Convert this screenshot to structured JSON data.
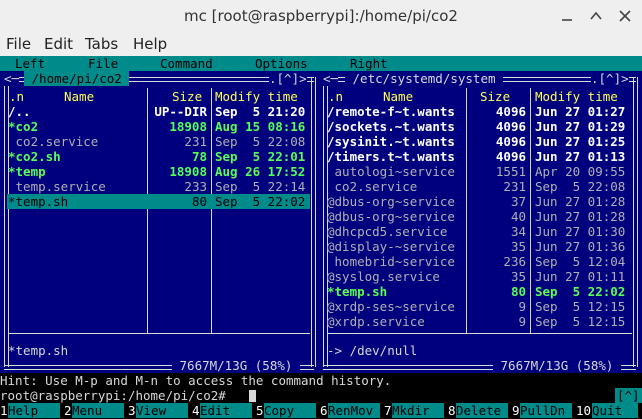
{
  "window": {
    "title": "mc [root@raspberrypi]:/home/pi/co2"
  },
  "app_menu": [
    "File",
    "Edit",
    "Tabs",
    "Help"
  ],
  "mc_menu": [
    "Left",
    "File",
    "Command",
    "Options",
    "Right"
  ],
  "left": {
    "path": " /home/pi/co2 ",
    "corner": ".[^]>",
    "cols": {
      "n": ".n",
      "name": "Name",
      "size": "Size",
      "modify": "Modify time"
    },
    "files": [
      {
        "n": "/..",
        "size": "UP--DIR",
        "mod": "Sep  5 21:20",
        "kind": "updir"
      },
      {
        "n": "*co2",
        "size": "18908",
        "mod": "Aug 15 08:16",
        "kind": "exec"
      },
      {
        "n": " co2.service",
        "size": "231",
        "mod": "Sep  5 22:08",
        "kind": "file"
      },
      {
        "n": "*co2.sh",
        "size": "78",
        "mod": "Sep  5 22:01",
        "kind": "exec"
      },
      {
        "n": "*temp",
        "size": "18908",
        "mod": "Aug 26 17:52",
        "kind": "exec"
      },
      {
        "n": " temp.service",
        "size": "233",
        "mod": "Sep  5 22:14",
        "kind": "file"
      },
      {
        "n": "*temp.sh",
        "size": "80",
        "mod": "Sep  5 22:02",
        "kind": "selected"
      }
    ],
    "status": "*temp.sh",
    "disk": " 7667M/13G (58%) "
  },
  "right": {
    "path": " /etc/systemd/system ",
    "corner": ".[^]>",
    "cols": {
      "n": ".n",
      "name": "Name",
      "size": "Size",
      "modify": "Modify time"
    },
    "files": [
      {
        "n": "/remote-f~t.wants",
        "size": "4096",
        "mod": "Jun 27 01:27",
        "kind": "dir"
      },
      {
        "n": "/sockets.~t.wants",
        "size": "4096",
        "mod": "Jun 27 01:29",
        "kind": "dir"
      },
      {
        "n": "/sysinit.~t.wants",
        "size": "4096",
        "mod": "Jun 27 01:25",
        "kind": "dir"
      },
      {
        "n": "/timers.t~t.wants",
        "size": "4096",
        "mod": "Jun 27 01:13",
        "kind": "dir"
      },
      {
        "n": " autologi~service",
        "size": "1551",
        "mod": "Apr 20 09:55",
        "kind": "file"
      },
      {
        "n": " co2.service",
        "size": "231",
        "mod": "Sep  5 22:08",
        "kind": "file"
      },
      {
        "n": "@dbus-org~service",
        "size": "37",
        "mod": "Jun 27 01:28",
        "kind": "file"
      },
      {
        "n": "@dbus-org~service",
        "size": "40",
        "mod": "Jun 27 01:28",
        "kind": "file"
      },
      {
        "n": "@dhcpcd5.service",
        "size": "34",
        "mod": "Jun 27 01:30",
        "kind": "file"
      },
      {
        "n": "@display-~service",
        "size": "35",
        "mod": "Jun 27 01:36",
        "kind": "file"
      },
      {
        "n": " homebrid~service",
        "size": "236",
        "mod": "Sep  5 12:04",
        "kind": "file"
      },
      {
        "n": "@syslog.service",
        "size": "35",
        "mod": "Jun 27 01:11",
        "kind": "file"
      },
      {
        "n": "*temp.sh",
        "size": "80",
        "mod": "Sep  5 22:02",
        "kind": "exec"
      },
      {
        "n": "@xrdp-ses~service",
        "size": "9",
        "mod": "Sep  5 12:15",
        "kind": "file"
      },
      {
        "n": "@xrdp.service",
        "size": "9",
        "mod": "Sep  5 12:15",
        "kind": "file"
      }
    ],
    "status": "-> /dev/null",
    "disk": " 7667M/13G (58%) "
  },
  "hint": "Hint: Use M-p and M-n to access the command history.",
  "hint_corner": "[^]",
  "prompt": "root@raspberrypi:/home/pi/co2# ",
  "fkeys": [
    {
      "num": "1",
      "label": "Help"
    },
    {
      "num": "2",
      "label": "Menu"
    },
    {
      "num": "3",
      "label": "View"
    },
    {
      "num": "4",
      "label": "Edit"
    },
    {
      "num": "5",
      "label": "Copy"
    },
    {
      "num": "6",
      "label": "RenMov"
    },
    {
      "num": "7",
      "label": "Mkdir"
    },
    {
      "num": "8",
      "label": "Delete"
    },
    {
      "num": "9",
      "label": "PullDn"
    },
    {
      "num": "10",
      "label": "Quit"
    }
  ],
  "colors": {
    "bg": "#00007f",
    "cyan": "#008b8b",
    "exec": "#55ff55",
    "file": "#b0b0b0",
    "white": "#ffffff",
    "yellow": "#ffff55"
  }
}
